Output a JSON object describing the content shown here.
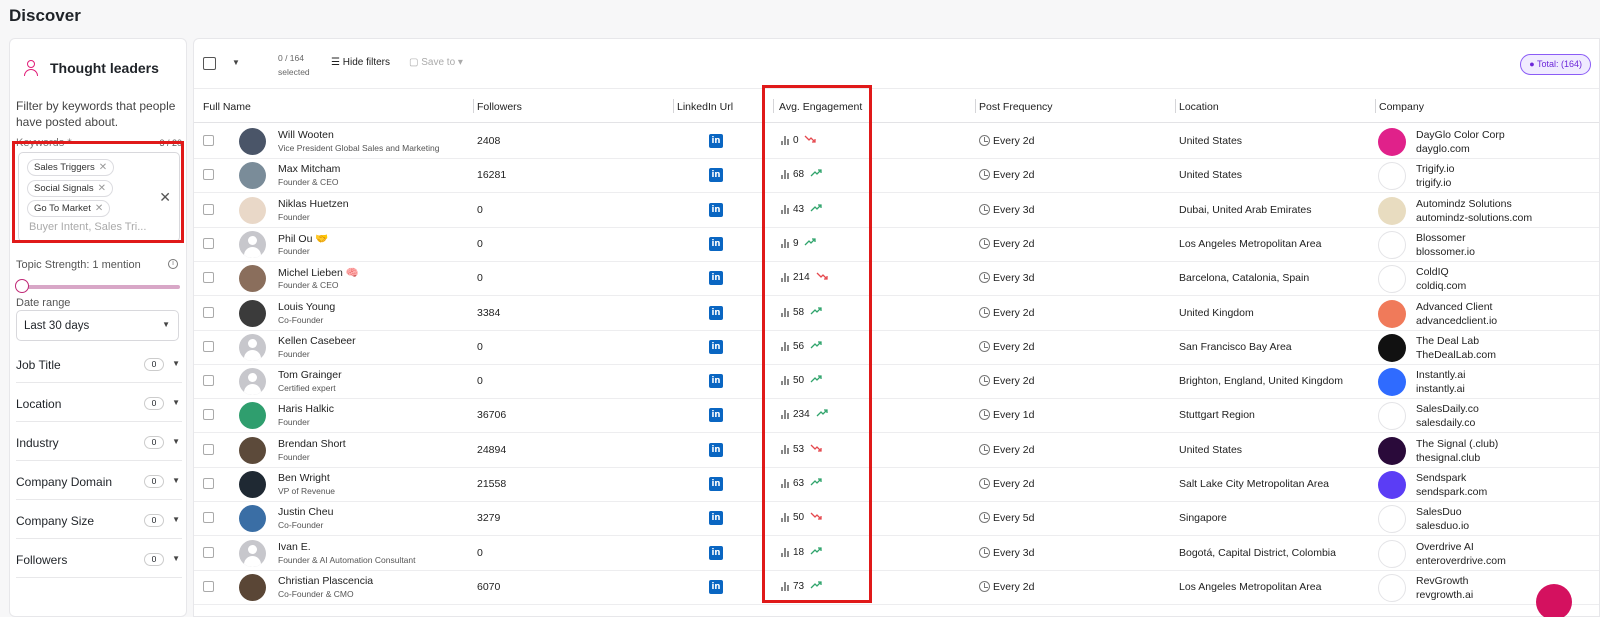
{
  "page": {
    "title": "Discover"
  },
  "sidebar": {
    "title": "Thought leaders",
    "description": "Filter by keywords that people have posted about.",
    "keywords_label": "Keywords *",
    "keywords_count": "3 / 20",
    "keywords": [
      "Sales Triggers",
      "Social Signals",
      "Go To Market"
    ],
    "keywords_placeholder": "Buyer Intent, Sales Tri...",
    "topic_strength": "Topic Strength: 1 mention",
    "date_range_label": "Date range",
    "date_range_value": "Last 30 days",
    "filters": [
      {
        "label": "Job Title",
        "count": "0"
      },
      {
        "label": "Location",
        "count": "0"
      },
      {
        "label": "Industry",
        "count": "0"
      },
      {
        "label": "Company Domain",
        "count": "0"
      },
      {
        "label": "Company Size",
        "count": "0"
      },
      {
        "label": "Followers",
        "count": "0"
      }
    ]
  },
  "toolbar": {
    "selected_count": "0 / 164",
    "selected_label": "selected",
    "hide_filters": "Hide filters",
    "save_to": "Save to",
    "total": "Total: (164)"
  },
  "table": {
    "columns": [
      "Full Name",
      "Followers",
      "LinkedIn Url",
      "Avg. Engagement",
      "Post Frequency",
      "Location",
      "Company"
    ],
    "linkedin_glyph": "in",
    "rows": [
      {
        "name": "Will Wooten",
        "title": "Vice President Global Sales and Marketing",
        "followers": "2408",
        "engagement": "0",
        "trend": "down",
        "frequency": "Every 2d",
        "location": "United States",
        "company": "DayGlo Color Corp",
        "domain": "dayglo.com",
        "avatar_color": "#4a5568",
        "logo_color": "#e0218a",
        "logo_text": ""
      },
      {
        "name": "Max Mitcham",
        "title": "Founder & CEO",
        "followers": "16281",
        "engagement": "68",
        "trend": "up",
        "frequency": "Every 2d",
        "location": "United States",
        "company": "Trigify.io",
        "domain": "trigify.io",
        "avatar_color": "#7a8c99",
        "logo_color": "#ffffff",
        "logo_text": ""
      },
      {
        "name": "Niklas Huetzen",
        "title": "Founder",
        "followers": "0",
        "engagement": "43",
        "trend": "up",
        "frequency": "Every 3d",
        "location": "Dubai, United Arab Emirates",
        "company": "Automindz Solutions",
        "domain": "automindz-solutions.com",
        "avatar_color": "#e9d8c8",
        "logo_color": "#e8dcc0",
        "logo_text": ""
      },
      {
        "name": "Phil Ou 🤝",
        "title": "Founder",
        "followers": "0",
        "engagement": "9",
        "trend": "up",
        "frequency": "Every 2d",
        "location": "Los Angeles Metropolitan Area",
        "company": "Blossomer",
        "domain": "blossomer.io",
        "avatar_color": "",
        "logo_color": "#ffffff",
        "logo_text": ""
      },
      {
        "name": "Michel Lieben 🧠",
        "title": "Founder & CEO",
        "followers": "0",
        "engagement": "214",
        "trend": "down",
        "frequency": "Every 3d",
        "location": "Barcelona, Catalonia, Spain",
        "company": "ColdIQ",
        "domain": "coldiq.com",
        "avatar_color": "#8a6e5c",
        "logo_color": "#ffffff",
        "logo_text": ""
      },
      {
        "name": "Louis Young",
        "title": "Co-Founder",
        "followers": "3384",
        "engagement": "58",
        "trend": "up",
        "frequency": "Every 2d",
        "location": "United Kingdom",
        "company": "Advanced Client",
        "domain": "advancedclient.io",
        "avatar_color": "#3b3b3b",
        "logo_color": "#f07a5a",
        "logo_text": ""
      },
      {
        "name": "Kellen Casebeer",
        "title": "Founder",
        "followers": "0",
        "engagement": "56",
        "trend": "up",
        "frequency": "Every 2d",
        "location": "San Francisco Bay Area",
        "company": "The Deal Lab",
        "domain": "TheDealLab.com",
        "avatar_color": "",
        "logo_color": "#111111",
        "logo_text": ""
      },
      {
        "name": "Tom Grainger",
        "title": "Certified expert",
        "followers": "0",
        "engagement": "50",
        "trend": "up",
        "frequency": "Every 2d",
        "location": "Brighton, England, United Kingdom",
        "company": "Instantly.ai",
        "domain": "instantly.ai",
        "avatar_color": "",
        "logo_color": "#2f6bff",
        "logo_text": ""
      },
      {
        "name": "Haris Halkic",
        "title": "Founder",
        "followers": "36706",
        "engagement": "234",
        "trend": "up",
        "frequency": "Every 1d",
        "location": "Stuttgart Region",
        "company": "SalesDaily.co",
        "domain": "salesdaily.co",
        "avatar_color": "#2f9e6e",
        "logo_color": "#ffffff",
        "logo_text": ""
      },
      {
        "name": "Brendan Short",
        "title": "Founder",
        "followers": "24894",
        "engagement": "53",
        "trend": "down",
        "frequency": "Every 2d",
        "location": "United States",
        "company": "The Signal (.club)",
        "domain": "thesignal.club",
        "avatar_color": "#5c4a3a",
        "logo_color": "#2a0a3a",
        "logo_text": ""
      },
      {
        "name": "Ben Wright",
        "title": "VP of Revenue",
        "followers": "21558",
        "engagement": "63",
        "trend": "up",
        "frequency": "Every 2d",
        "location": "Salt Lake City Metropolitan Area",
        "company": "Sendspark",
        "domain": "sendspark.com",
        "avatar_color": "#1f2933",
        "logo_color": "#5b3df5",
        "logo_text": ""
      },
      {
        "name": "Justin Cheu",
        "title": "Co-Founder",
        "followers": "3279",
        "engagement": "50",
        "trend": "down",
        "frequency": "Every 5d",
        "location": "Singapore",
        "company": "SalesDuo",
        "domain": "salesduo.io",
        "avatar_color": "#3a6ea5",
        "logo_color": "#ffffff",
        "logo_text": ""
      },
      {
        "name": "Ivan E.",
        "title": "Founder & AI Automation Consultant",
        "followers": "0",
        "engagement": "18",
        "trend": "up",
        "frequency": "Every 3d",
        "location": "Bogotá, Capital District, Colombia",
        "company": "Overdrive AI",
        "domain": "enteroverdrive.com",
        "avatar_color": "",
        "logo_color": "#ffffff",
        "logo_text": ""
      },
      {
        "name": "Christian Plascencia",
        "title": "Co-Founder & CMO",
        "followers": "6070",
        "engagement": "73",
        "trend": "up",
        "frequency": "Every 2d",
        "location": "Los Angeles Metropolitan Area",
        "company": "RevGrowth",
        "domain": "revgrowth.ai",
        "avatar_color": "#5a4636",
        "logo_color": "#ffffff",
        "logo_text": ""
      }
    ]
  }
}
